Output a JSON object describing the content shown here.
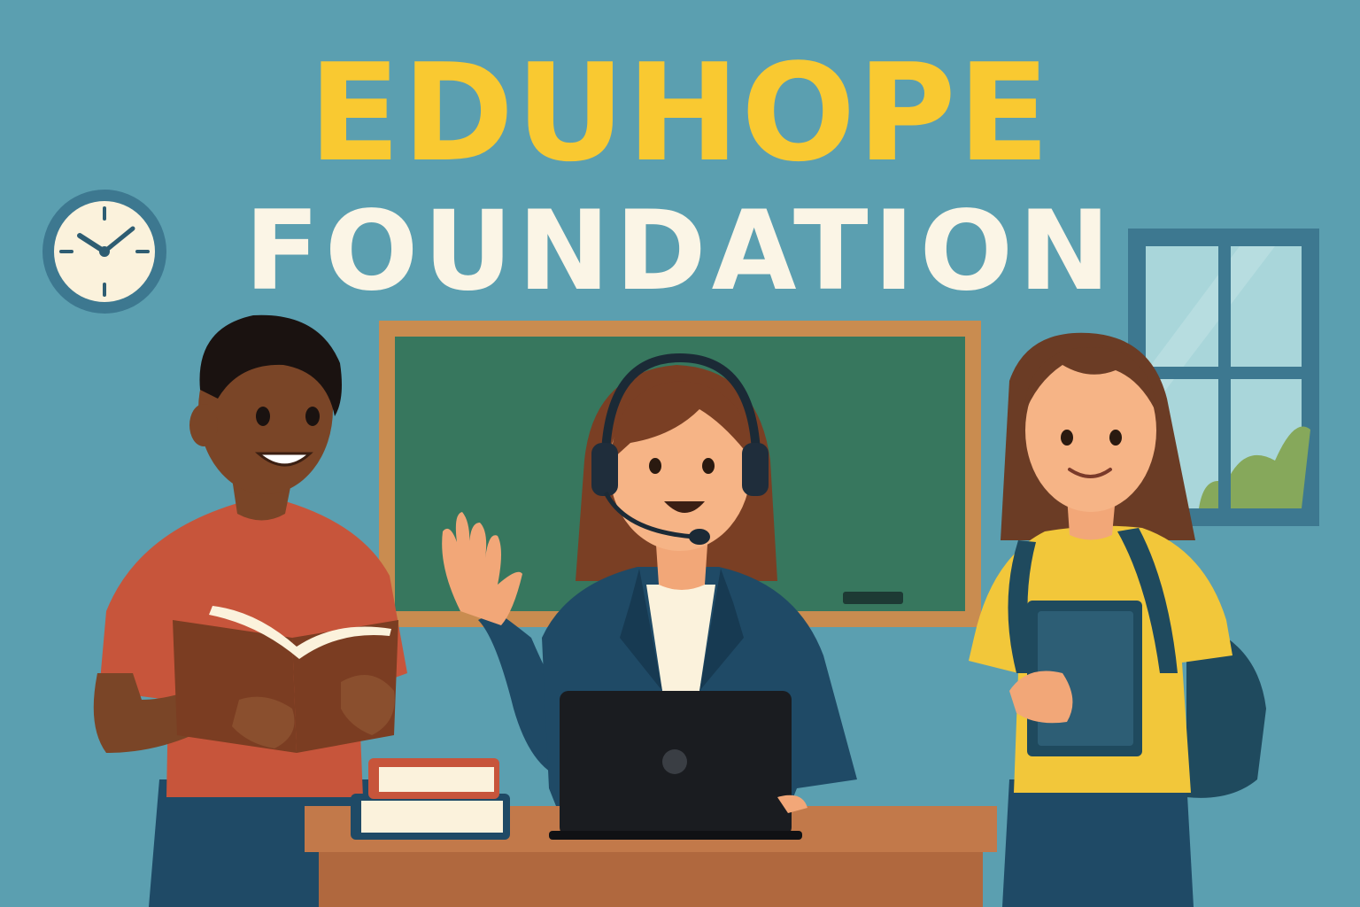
{
  "banner": {
    "title_line_1": "EDUHOPE",
    "title_line_2": "FOUNDATION"
  },
  "colors": {
    "wall": "#5b9fb0",
    "title_primary": "#f9c931",
    "title_secondary": "#fbf5e6",
    "chalkboard": "#37775e",
    "chalkboard_frame": "#c98c50",
    "desk": "#c2794a",
    "teacher_blazer": "#1f4a66",
    "left_student_shirt": "#c7553b",
    "right_student_shirt": "#f2c73a",
    "backpack": "#1f4a5e"
  },
  "icons": [
    "wall-clock-icon",
    "window-icon",
    "headset-icon",
    "laptop-icon",
    "book-stack-icon",
    "open-book-icon",
    "notebook-icon",
    "backpack-icon"
  ]
}
